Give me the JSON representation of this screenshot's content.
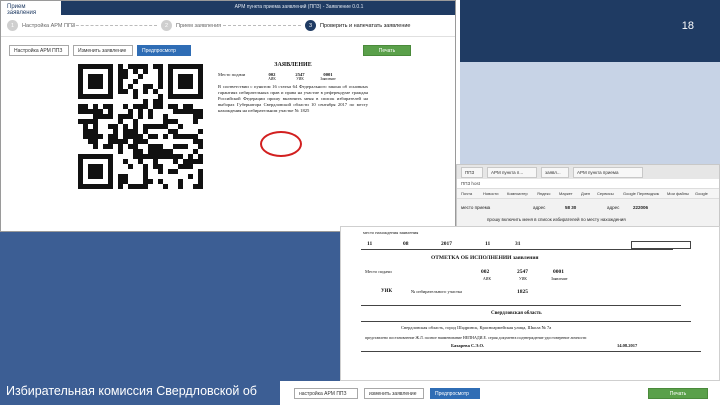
{
  "slide": {
    "number": "18",
    "footer": "Избирательная комиссия Свердловской об"
  },
  "app": {
    "tab": "Прием заявления",
    "title": "АРМ пункта приема заявлений (ППЗ) - Заявление 0.0.1",
    "steps": [
      {
        "num": "1",
        "label": "Настройка АРМ ППЗ"
      },
      {
        "num": "2",
        "label": "Прием заявления"
      },
      {
        "num": "3",
        "label": "Проверить и напечатать заявление"
      }
    ],
    "toolbar": {
      "settings": "Настройка АРМ ППЗ",
      "edit": "Изменить заявление",
      "preview": "Предпросмотр",
      "print": "Печать"
    }
  },
  "document": {
    "title": "ЗАЯВЛЕНИЕ",
    "place_label": "Место подачи",
    "codes": [
      "002",
      "2547",
      "0001"
    ],
    "code_labels": [
      "АИК",
      "УИК",
      "Заявление"
    ],
    "body": "В соответствии с пунктом 16 статьи 64 Федерального закона об основных гарантиях избирательных прав и права на участие в референдуме граждан Российской Федерации прошу включить меня в список избирателей на выборах Губернатора Свердловской области 10 сентября 2017 по месту нахождения на избирательном участке № 1825"
  },
  "browser": {
    "tabs": [
      "ППЗ",
      "АРМ пункта п...",
      "заявл...",
      "АРМ пункта приема"
    ],
    "address": "ППЗ host",
    "bookmarks": [
      "Почта",
      "Новости",
      "Компьютер",
      "Яндекс",
      "Маркет",
      "Дзен",
      "Сервисы",
      "Google Переводчик",
      "Мои файлы",
      "Google"
    ],
    "row1": "место приема",
    "row1b": "адрес",
    "row1c": "58 30",
    "row1d": "адрес",
    "row1e": "222006",
    "row2": "прошу включить меня в список избирателей по месту нахождения"
  },
  "form": {
    "header": "место нахождения заявления",
    "date_row": [
      "11",
      "08",
      "2017",
      "11",
      "31"
    ],
    "heading": "ОТМЕТКА ОБ ИСПОЛНЕНИИ заявления",
    "place_label": "Место подачи",
    "codes": [
      "002",
      "2547",
      "0001"
    ],
    "code_labels": [
      "АИК",
      "УИК",
      "Заявление"
    ],
    "station_label": "УИК",
    "station_line": "№ избирательного участка",
    "station_number": "1825",
    "name_row": "Свердловская область",
    "address_row": "Свердловская область, город Шадринск, Красноармейская улица, Школа № 7а",
    "signature_row": "Бахарева С.Э.О.",
    "date_value": "14.08.2017",
    "doc_row": "представлено постановление Ж.Л. полное наименование НЕПНАДИ.Е. серия документа подтверждение удостоверение личности"
  },
  "bottom_toolbar": {
    "settings": "настройка АРМ ППЗ",
    "edit": "изменить заявление",
    "preview": "Предпросмотр",
    "print": "Печать"
  }
}
